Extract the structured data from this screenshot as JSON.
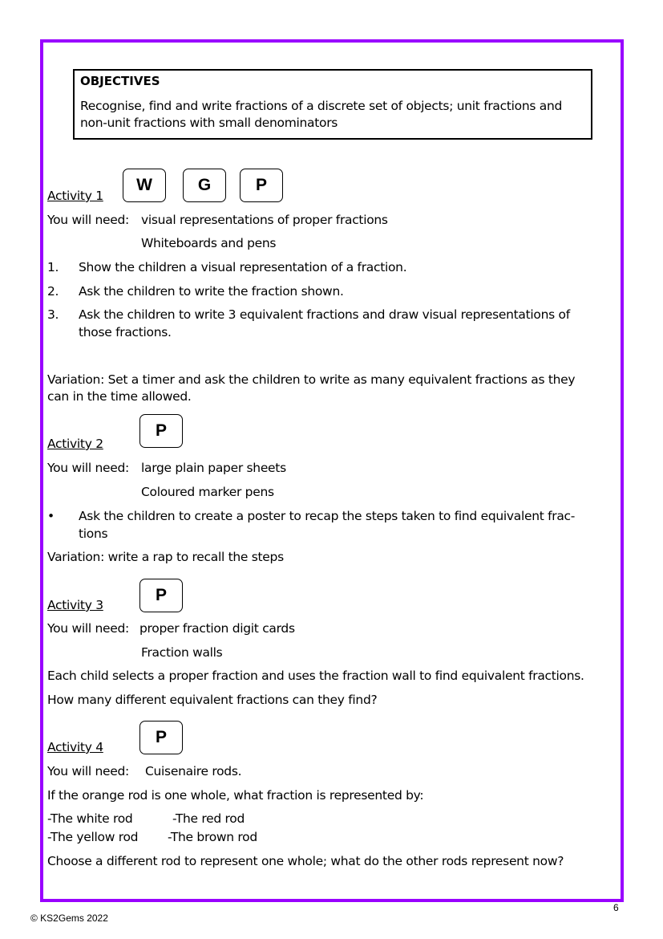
{
  "objectives": {
    "title": "OBJECTIVES",
    "text": "Recognise, find and write fractions of a discrete set of objects; unit fractions and non-unit fractions with small denominators"
  },
  "activities": [
    {
      "title": "Activity 1",
      "badges": [
        "W",
        "G",
        "P"
      ],
      "need_label": "You will need:",
      "needs": [
        "visual representations of proper fractions",
        "Whiteboards and pens"
      ],
      "steps": [
        {
          "marker": "1.",
          "text": "Show the children a visual representation of a fraction."
        },
        {
          "marker": "2.",
          "text": "Ask the children to write the fraction shown."
        },
        {
          "marker": "3.",
          "text": "Ask the children to write 3 equivalent fractions and draw visual representations of",
          "text2": "those fractions."
        }
      ],
      "variation": "Variation: Set a timer and ask the children to write as many equivalent fractions as they",
      "variation2": "can in  the time allowed."
    },
    {
      "title": "Activity 2",
      "badges": [
        "P"
      ],
      "need_label": "You will need:",
      "needs": [
        "large plain paper sheets",
        "Coloured marker pens"
      ],
      "bullet": "•",
      "bullet_text": "Ask the children to create a poster to recap the steps taken to  find equivalent frac-",
      "bullet_text2": "tions",
      "variation": "Variation: write a rap to recall the steps"
    },
    {
      "title": "Activity 3",
      "badges": [
        "P"
      ],
      "need_label": "You will need:",
      "needs": [
        "proper fraction digit cards",
        "Fraction walls"
      ],
      "lines": [
        "Each child selects a proper fraction and uses the fraction wall to find equivalent fractions.",
        "How many different equivalent fractions can they find?"
      ]
    },
    {
      "title": "Activity 4",
      "badges": [
        "P"
      ],
      "need_label": "You will need:",
      "needs": [
        "Cuisenaire rods."
      ],
      "question": "If the orange rod is one whole, what fraction is represented by:",
      "rods": [
        "-The white rod",
        "-The red rod",
        "-The yellow rod",
        "-The brown rod"
      ],
      "closing": "Choose a different rod to represent one whole; what do the other rods represent now?"
    }
  ],
  "footer": {
    "copyright": "© KS2Gems 2022",
    "page_number": "6"
  },
  "colors": {
    "frame": "#9900ff"
  }
}
